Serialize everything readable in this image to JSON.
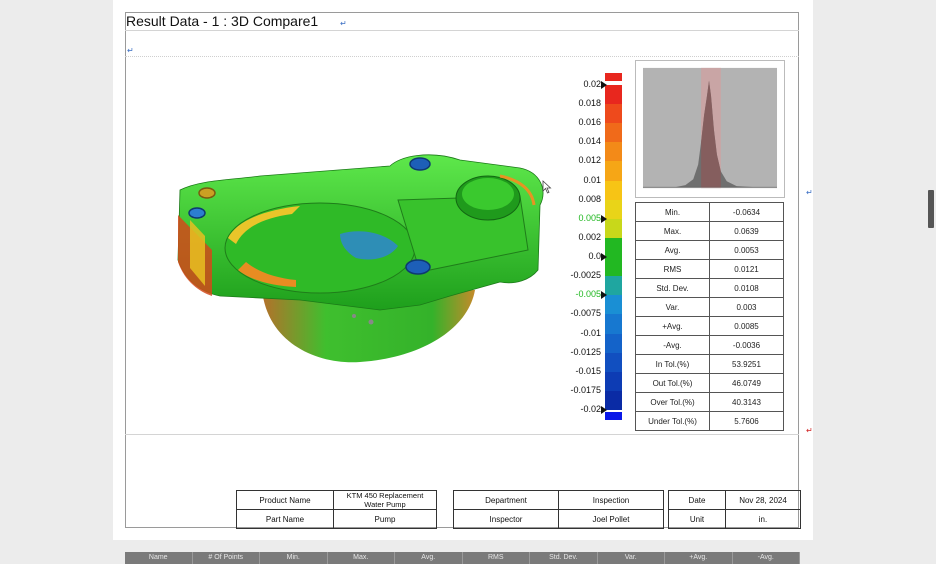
{
  "title": "Result Data - 1  :  3D Compare1",
  "legend": {
    "ticks": [
      {
        "label": "0.02",
        "arrow": true,
        "green": false
      },
      {
        "label": "0.018",
        "arrow": false,
        "green": false
      },
      {
        "label": "0.016",
        "arrow": false,
        "green": false
      },
      {
        "label": "0.014",
        "arrow": false,
        "green": false
      },
      {
        "label": "0.012",
        "arrow": false,
        "green": false
      },
      {
        "label": "0.01",
        "arrow": false,
        "green": false
      },
      {
        "label": "0.008",
        "arrow": false,
        "green": false
      },
      {
        "label": "0.005",
        "arrow": true,
        "green": true
      },
      {
        "label": "0.002",
        "arrow": false,
        "green": false
      },
      {
        "label": "0.0",
        "arrow": true,
        "green": false
      },
      {
        "label": "-0.0025",
        "arrow": false,
        "green": false
      },
      {
        "label": "-0.005",
        "arrow": true,
        "green": true
      },
      {
        "label": "-0.0075",
        "arrow": false,
        "green": false
      },
      {
        "label": "-0.01",
        "arrow": false,
        "green": false
      },
      {
        "label": "-0.0125",
        "arrow": false,
        "green": false
      },
      {
        "label": "-0.015",
        "arrow": false,
        "green": false
      },
      {
        "label": "-0.0175",
        "arrow": false,
        "green": false
      },
      {
        "label": "-0.02",
        "arrow": true,
        "green": false
      }
    ],
    "colors": [
      "#e8271e",
      "#ee4a1c",
      "#f06a1a",
      "#f38a18",
      "#f6a616",
      "#f7c415",
      "#e9d418",
      "#c8d81a",
      "#22b822",
      "#22b822",
      "#1fa6a0",
      "#1a8fd4",
      "#1778d0",
      "#1463c9",
      "#114fc0",
      "#0d3cb4",
      "#0a2ba5",
      "#0618e8"
    ]
  },
  "stats": [
    {
      "label": "Min.",
      "value": "-0.0634"
    },
    {
      "label": "Max.",
      "value": "0.0639"
    },
    {
      "label": "Avg.",
      "value": "0.0053"
    },
    {
      "label": "RMS",
      "value": "0.0121"
    },
    {
      "label": "Std. Dev.",
      "value": "0.0108"
    },
    {
      "label": "Var.",
      "value": "0.003"
    },
    {
      "label": "+Avg.",
      "value": "0.0085"
    },
    {
      "label": "-Avg.",
      "value": "-0.0036"
    },
    {
      "label": "In Tol.(%)",
      "value": "53.9251"
    },
    {
      "label": "Out Tol.(%)",
      "value": "46.0749"
    },
    {
      "label": "Over Tol.(%)",
      "value": "40.3143"
    },
    {
      "label": "Under Tol.(%)",
      "value": "5.7606"
    }
  ],
  "info": {
    "product_name_label": "Product Name",
    "product_name_value": "KTM 450 Replacement Water Pump",
    "part_name_label": "Part Name",
    "part_name_value": "Pump",
    "department_label": "Department",
    "department_value": "Inspection",
    "inspector_label": "Inspector",
    "inspector_value": "Joel Pollet",
    "date_label": "Date",
    "date_value": "Nov 28, 2024",
    "unit_label": "Unit",
    "unit_value": "in."
  },
  "bottom_table_headers": [
    "Name",
    "# Of Points",
    "Min.",
    "Max.",
    "Avg.",
    "RMS",
    "Std. Dev.",
    "Var.",
    "+Avg.",
    "-Avg."
  ]
}
